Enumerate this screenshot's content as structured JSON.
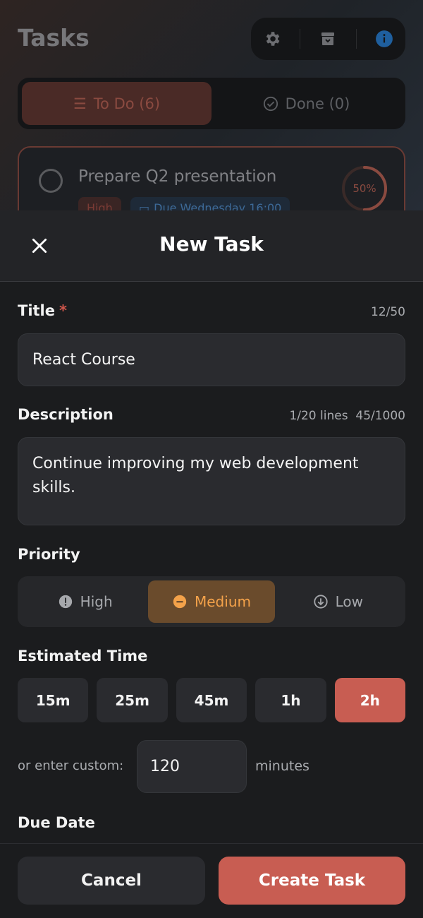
{
  "background": {
    "app_title": "Tasks",
    "toolbar": {
      "settings_icon": "gear-icon",
      "archive_icon": "archive-box-icon",
      "info_icon": "info-circle-icon"
    },
    "tabs": [
      {
        "label": "To Do (6)",
        "icon": "list-icon",
        "active": true
      },
      {
        "label": "Done (0)",
        "icon": "check-circle-icon",
        "active": false
      }
    ],
    "card": {
      "title": "Prepare Q2 presentation",
      "priority_tag": "High",
      "due_tag": "Due Wednesday 16:00",
      "progress_label": "50%",
      "progress": 0.5
    }
  },
  "modal": {
    "title": "New Task",
    "close_icon": "close-icon",
    "title_field": {
      "label": "Title",
      "required_mark": "*",
      "counter": "12/50",
      "value": "React Course"
    },
    "description_field": {
      "label": "Description",
      "lines_counter": "1/20 lines",
      "char_counter": "45/1000",
      "value": "Continue improving my web development skills."
    },
    "priority": {
      "label": "Priority",
      "options": [
        {
          "label": "High",
          "icon": "exclamation-circle-icon",
          "selected": false
        },
        {
          "label": "Medium",
          "icon": "minus-circle-icon",
          "selected": true
        },
        {
          "label": "Low",
          "icon": "arrow-down-circle-icon",
          "selected": false
        }
      ]
    },
    "estimated_time": {
      "label": "Estimated Time",
      "presets": [
        {
          "label": "15m",
          "selected": false
        },
        {
          "label": "25m",
          "selected": false
        },
        {
          "label": "45m",
          "selected": false
        },
        {
          "label": "1h",
          "selected": false
        },
        {
          "label": "2h",
          "selected": true
        }
      ],
      "custom_label": "or enter custom:",
      "custom_value": "120",
      "custom_unit": "minutes"
    },
    "due_date": {
      "label": "Due Date"
    },
    "actions": {
      "cancel": "Cancel",
      "create": "Create Task"
    }
  },
  "colors": {
    "accent": "#c85d52",
    "medium": "#f4a24a",
    "info": "#2f7fd6",
    "surface": "#2a2b2f"
  }
}
